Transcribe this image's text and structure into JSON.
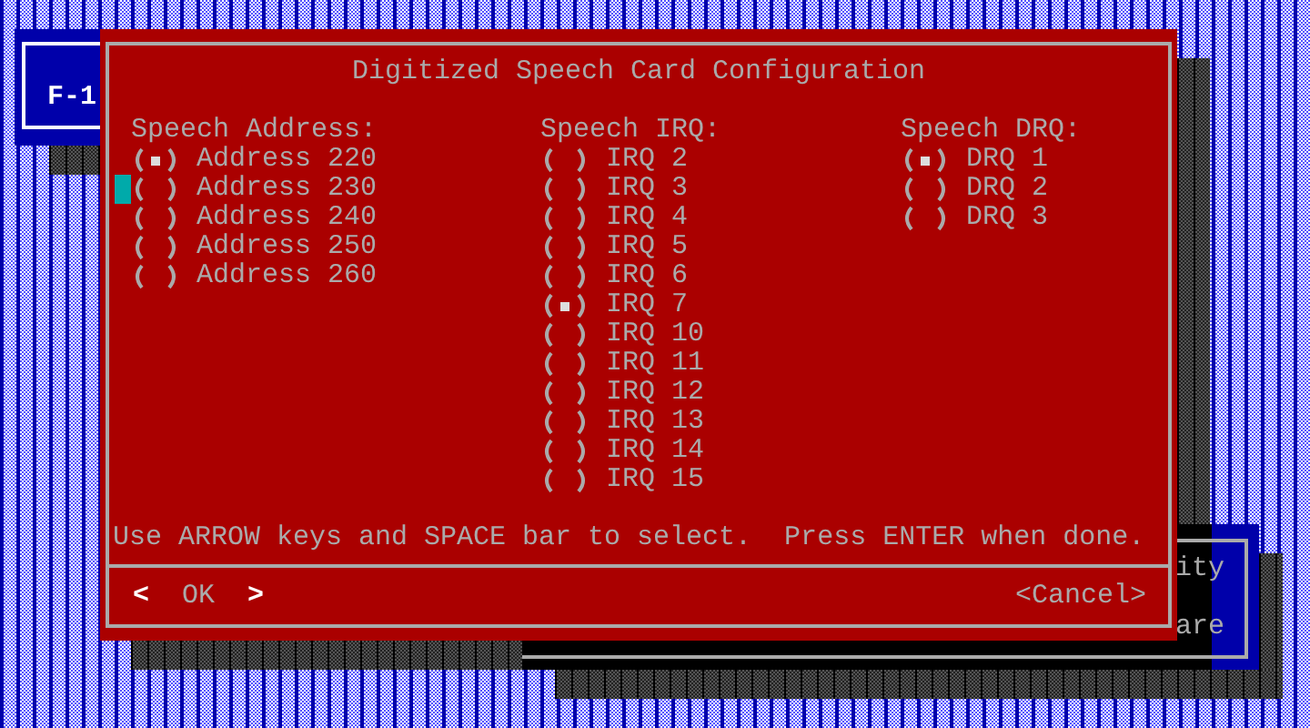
{
  "left_window": {
    "label": "F-1"
  },
  "right_window": {
    "lines": [
      "ity",
      "are"
    ]
  },
  "dialog": {
    "title": "Digitized Speech Card Configuration",
    "groups": [
      {
        "label": "Speech Address:",
        "options": [
          {
            "label": "Address 220",
            "selected": true,
            "focused": false
          },
          {
            "label": "Address 230",
            "selected": false,
            "focused": true
          },
          {
            "label": "Address 240",
            "selected": false,
            "focused": false
          },
          {
            "label": "Address 250",
            "selected": false,
            "focused": false
          },
          {
            "label": "Address 260",
            "selected": false,
            "focused": false
          }
        ]
      },
      {
        "label": "Speech IRQ:",
        "options": [
          {
            "label": "IRQ 2",
            "selected": false,
            "focused": false
          },
          {
            "label": "IRQ 3",
            "selected": false,
            "focused": false
          },
          {
            "label": "IRQ 4",
            "selected": false,
            "focused": false
          },
          {
            "label": "IRQ 5",
            "selected": false,
            "focused": false
          },
          {
            "label": "IRQ 6",
            "selected": false,
            "focused": false
          },
          {
            "label": "IRQ 7",
            "selected": true,
            "focused": false
          },
          {
            "label": "IRQ 10",
            "selected": false,
            "focused": false
          },
          {
            "label": "IRQ 11",
            "selected": false,
            "focused": false
          },
          {
            "label": "IRQ 12",
            "selected": false,
            "focused": false
          },
          {
            "label": "IRQ 13",
            "selected": false,
            "focused": false
          },
          {
            "label": "IRQ 14",
            "selected": false,
            "focused": false
          },
          {
            "label": "IRQ 15",
            "selected": false,
            "focused": false
          }
        ]
      },
      {
        "label": "Speech DRQ:",
        "options": [
          {
            "label": "DRQ 1",
            "selected": true,
            "focused": false
          },
          {
            "label": "DRQ 2",
            "selected": false,
            "focused": false
          },
          {
            "label": "DRQ 3",
            "selected": false,
            "focused": false
          }
        ]
      }
    ],
    "instructions": "Use ARROW keys and SPACE bar to select.  Press ENTER when done.",
    "buttons": [
      {
        "open": "<",
        "label": "OK",
        "close": ">",
        "focused": true
      },
      {
        "open": "<",
        "label": "Cancel",
        "close": ">",
        "focused": false
      }
    ]
  }
}
